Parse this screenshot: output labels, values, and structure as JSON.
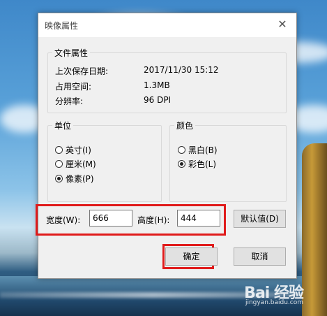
{
  "dialog": {
    "title": "映像属性",
    "close_icon": "close-icon"
  },
  "file_props": {
    "legend": "文件属性",
    "rows": [
      {
        "label": "上次保存日期:",
        "value": "2017/11/30 15:12"
      },
      {
        "label": "占用空间:",
        "value": "1.3MB"
      },
      {
        "label": "分辨率:",
        "value": "96 DPI"
      }
    ]
  },
  "units": {
    "legend": "单位",
    "options": [
      "英寸(I)",
      "厘米(M)",
      "像素(P)"
    ],
    "selected": "像素(P)"
  },
  "color": {
    "legend": "颜色",
    "options": [
      "黑白(B)",
      "彩色(L)"
    ],
    "selected": "彩色(L)"
  },
  "size": {
    "width_label": "宽度(W):",
    "width_value": "666",
    "height_label": "高度(H):",
    "height_value": "444",
    "default_button": "默认值(D)"
  },
  "buttons": {
    "ok": "确定",
    "cancel": "取消"
  },
  "watermark": {
    "main": "Bai 经验",
    "sub": "jingyan.baidu.com"
  },
  "colors": {
    "highlight": "#e01b1b",
    "dialog_bg": "#f0f0f0"
  }
}
